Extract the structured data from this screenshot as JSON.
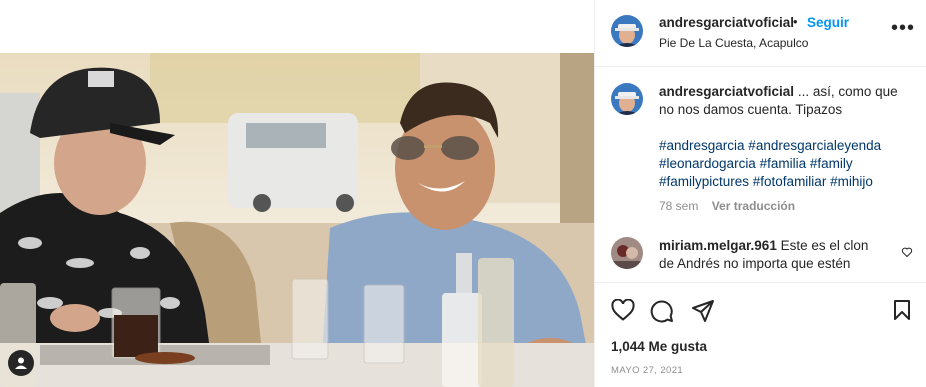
{
  "post": {
    "username": "andresgarciatvoficial",
    "separator": "•",
    "follow_label": "Seguir",
    "location": "Pie De La Cuesta, Acapulco",
    "more_icon": "more-horizontal-icon"
  },
  "caption": {
    "username": "andresgarciatvoficial",
    "text": " ... así, como que no nos damos cuenta. Tipazos",
    "hashtags": "#andresgarcia #andresgarcialeyenda #leonardogarcia #familia #family #familypictures #fotofamiliar #mihijo",
    "time_ago": "78 sem",
    "translate_label": "Ver traducción"
  },
  "comment": {
    "username": "miriam.melgar.961",
    "text": " Este es el clon de Andrés no importa que estén"
  },
  "actions": {
    "like_icon": "heart-icon",
    "comment_icon": "comment-icon",
    "share_icon": "share-icon",
    "save_icon": "bookmark-icon"
  },
  "likes_label": "1,044 Me gusta",
  "date_label": "MAYO 27, 2021",
  "colors": {
    "link": "#0095f6",
    "hashtag": "#00376b",
    "muted": "#8e8e8e"
  }
}
